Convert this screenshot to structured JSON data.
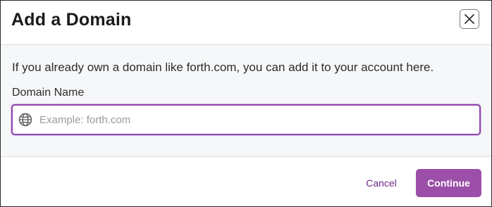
{
  "dialog": {
    "title": "Add a Domain",
    "close_icon": "close-icon"
  },
  "body": {
    "description": "If you already own a domain like forth.com, you can add it to your account here.",
    "field_label": "Domain Name",
    "input": {
      "value": "",
      "placeholder": "Example: forth.com",
      "icon": "globe-icon"
    }
  },
  "footer": {
    "cancel_label": "Cancel",
    "continue_label": "Continue"
  },
  "colors": {
    "accent": "#9b4fa8",
    "focus_border": "#8e44ad",
    "cancel_text": "#6d2a8a",
    "body_background": "#f6f7f9"
  }
}
